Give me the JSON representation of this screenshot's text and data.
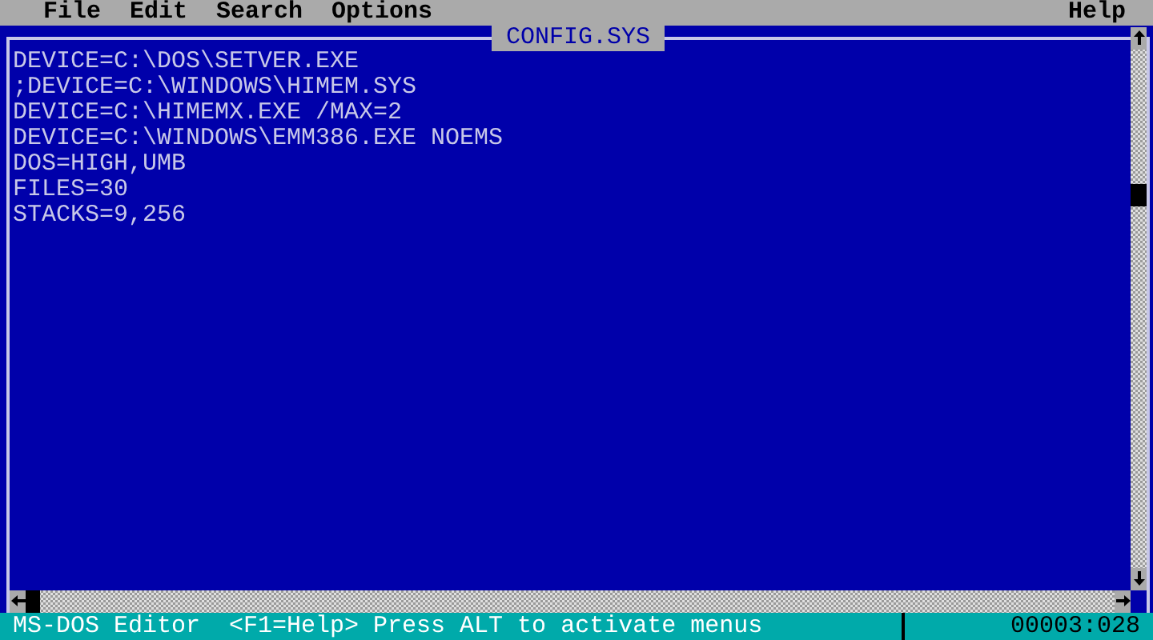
{
  "menu": [
    {
      "label": "File"
    },
    {
      "label": "Edit"
    },
    {
      "label": "Search"
    },
    {
      "label": "Options"
    }
  ],
  "help_menu": {
    "label": "Help"
  },
  "document": {
    "title": "CONFIG.SYS",
    "lines": [
      "DEVICE=C:\\DOS\\SETVER.EXE",
      ";DEVICE=C:\\WINDOWS\\HIMEM.SYS",
      "DEVICE=C:\\HIMEMX.EXE /MAX=2",
      "DEVICE=C:\\WINDOWS\\EMM386.EXE NOEMS",
      "DOS=HIGH,UMB",
      "FILES=30",
      "STACKS=9,256"
    ]
  },
  "status_bar": {
    "app_name": "MS-DOS Editor",
    "hint": "<F1=Help> Press ALT to activate menus",
    "position": "00003:028"
  }
}
